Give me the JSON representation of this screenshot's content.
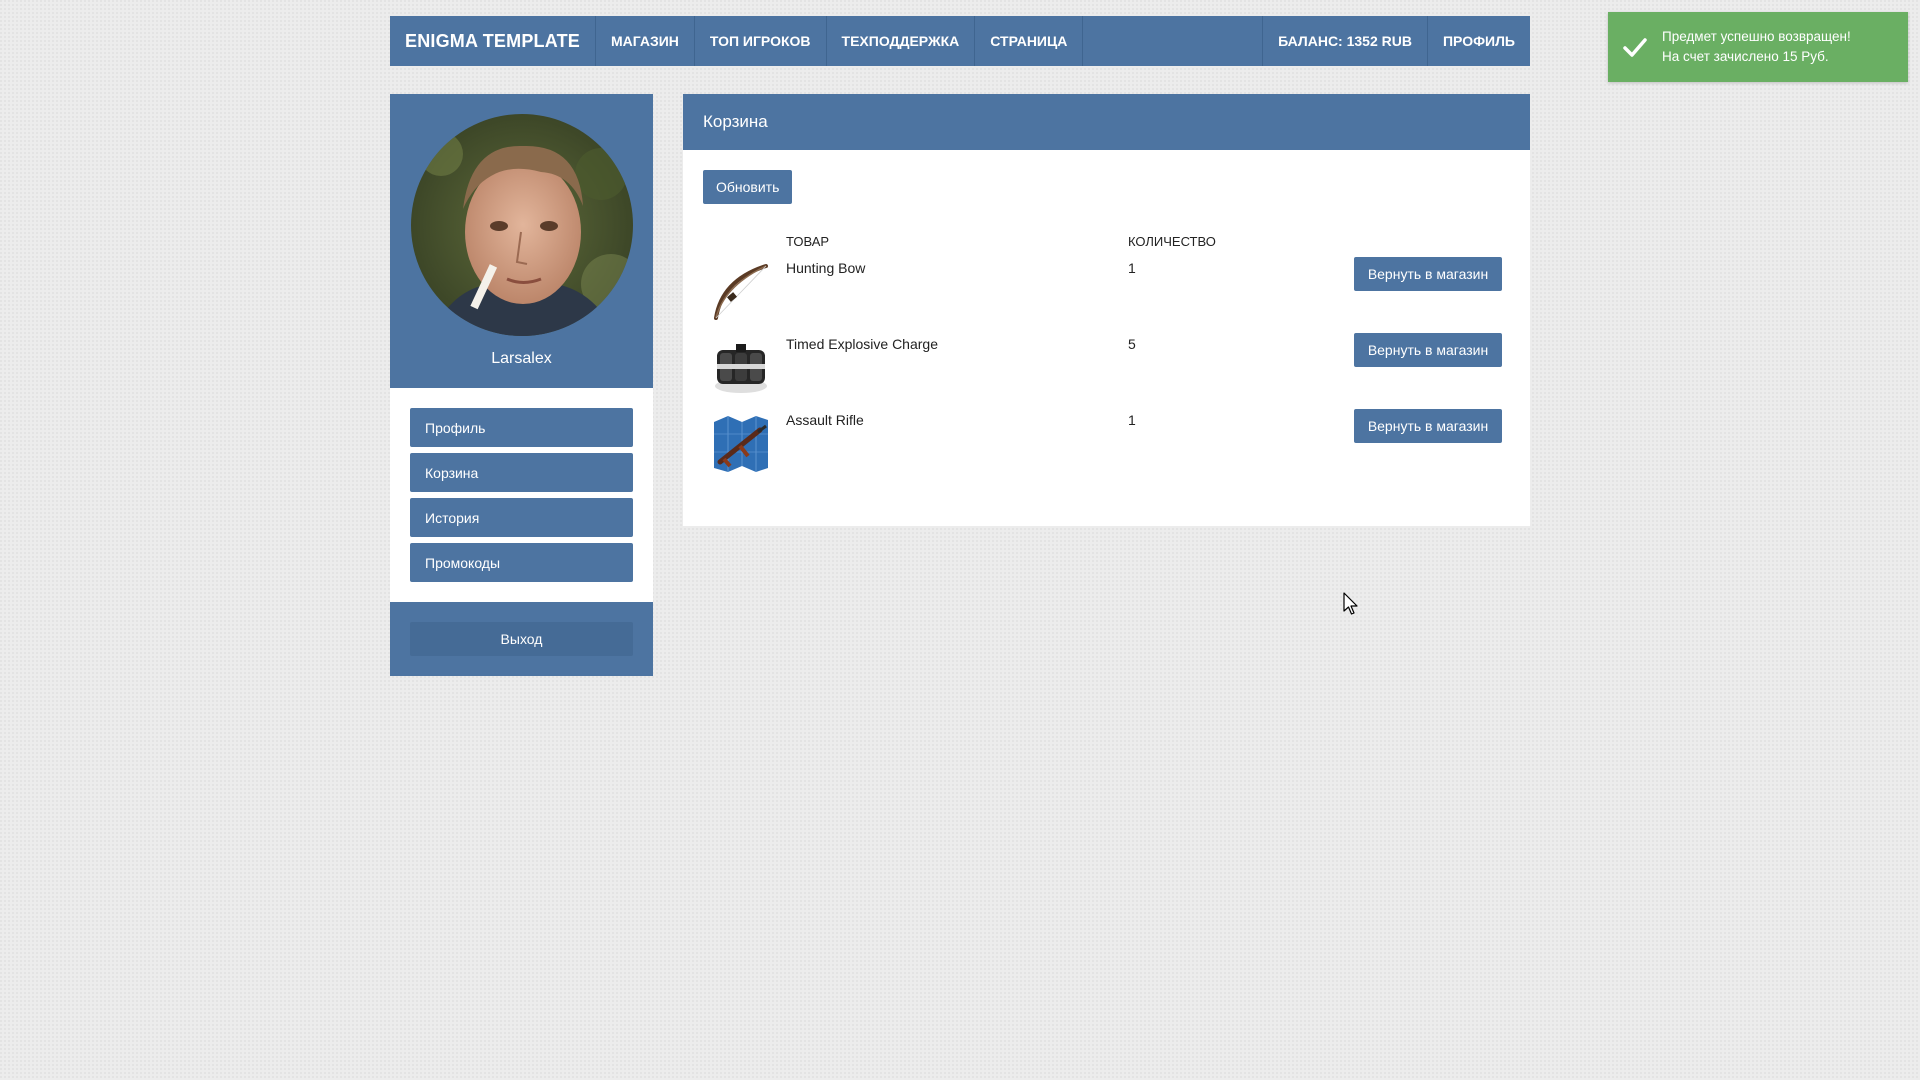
{
  "navbar": {
    "brand": "ENIGMA TEMPLATE",
    "items": [
      {
        "label": "МАГАЗИН"
      },
      {
        "label": "ТОП ИГРОКОВ"
      },
      {
        "label": "ТЕХПОДДЕРЖКА"
      },
      {
        "label": "СТРАНИЦА"
      }
    ],
    "balance": "БАЛАНС: 1352 RUB",
    "profile": "ПРОФИЛЬ"
  },
  "sidebar": {
    "username": "Larsalex",
    "menu": [
      {
        "label": "Профиль"
      },
      {
        "label": "Корзина"
      },
      {
        "label": "История"
      },
      {
        "label": "Промокоды"
      }
    ],
    "logout": "Выход"
  },
  "cart": {
    "title": "Корзина",
    "refresh_label": "Обновить",
    "col_item": "ТОВАР",
    "col_qty": "КОЛИЧЕСТВО",
    "items": [
      {
        "name": "Hunting Bow",
        "qty": "1",
        "action": "Вернуть в магазин",
        "icon": "bow-icon"
      },
      {
        "name": "Timed Explosive Charge",
        "qty": "5",
        "action": "Вернуть в магазин",
        "icon": "explosive-icon"
      },
      {
        "name": "Assault Rifle",
        "qty": "1",
        "action": "Вернуть в магазин",
        "icon": "rifle-blueprint-icon"
      }
    ]
  },
  "toast": {
    "line1": "Предмет успешно возвращен!",
    "line2": "На счет зачислено 15 Руб."
  },
  "colors": {
    "primary": "#4d74a1",
    "success": "#6aaf63",
    "background": "#ececec"
  }
}
